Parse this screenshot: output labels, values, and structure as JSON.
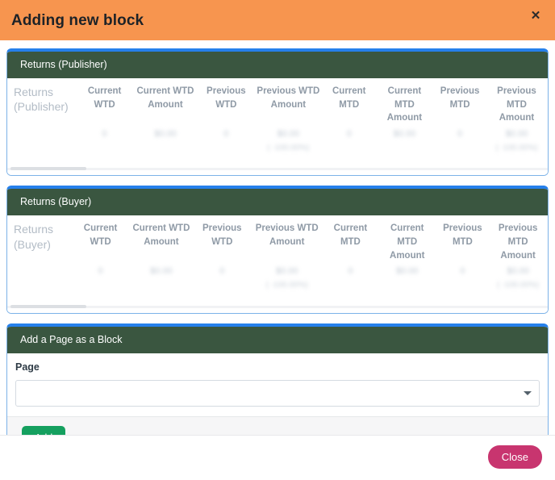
{
  "header": {
    "title": "Adding new block",
    "close_icon": "close-x-icon",
    "background_color": "#F7954F"
  },
  "panels": [
    {
      "title": "Returns (Publisher)",
      "row_label": "Returns (Publisher)",
      "columns": [
        "Current WTD",
        "Current WTD Amount",
        "Previous WTD",
        "Previous WTD Amount",
        "Current MTD",
        "Current MTD Amount",
        "Previous MTD",
        "Previous MTD Amount"
      ],
      "values": [
        "0",
        "$0.00",
        "0",
        "$0.00",
        "0",
        "$0.00",
        "0",
        "$0.00"
      ],
      "subvalues": [
        "",
        "",
        "",
        "( -100.00%)",
        "",
        "",
        "",
        "( -100.00%)"
      ],
      "accent_color": "#2680EB",
      "header_color": "#3A5640"
    },
    {
      "title": "Returns (Buyer)",
      "row_label": "Returns (Buyer)",
      "columns": [
        "Current WTD",
        "Current WTD Amount",
        "Previous WTD",
        "Previous WTD Amount",
        "Current MTD",
        "Current MTD Amount",
        "Previous MTD",
        "Previous MTD Amount"
      ],
      "values": [
        "0",
        "$0.00",
        "0",
        "$0.00",
        "0",
        "$0.00",
        "0",
        "$0.00"
      ],
      "subvalues": [
        "",
        "",
        "",
        "( -100.00%)",
        "",
        "",
        "",
        "( -100.00%)"
      ],
      "accent_color": "#2680EB",
      "header_color": "#3A5640"
    }
  ],
  "form_panel": {
    "title": "Add a Page as a Block",
    "field_label": "Page",
    "select_value": "",
    "select_placeholder": "",
    "caret_icon": "chevron-down-icon",
    "add_label": "Add",
    "add_color": "#15A05F"
  },
  "footer": {
    "close_label": "Close",
    "close_color": "#C8356F"
  }
}
